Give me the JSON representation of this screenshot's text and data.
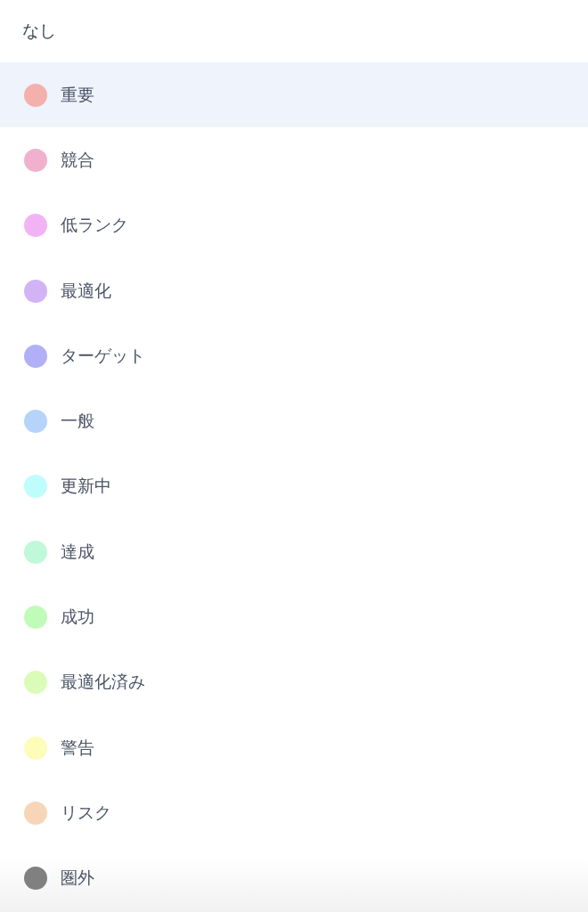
{
  "options": [
    {
      "label": "なし",
      "selected": false
    },
    {
      "label": "重要",
      "color": "#f4b0ab",
      "selected": true
    },
    {
      "label": "競合",
      "color": "#f2b0cf",
      "selected": false
    },
    {
      "label": "低ランク",
      "color": "#f2b3f5",
      "selected": false
    },
    {
      "label": "最適化",
      "color": "#d2b3f6",
      "selected": false
    },
    {
      "label": "ターゲット",
      "color": "#b1b0f7",
      "selected": false
    },
    {
      "label": "一般",
      "color": "#b6d3fa",
      "selected": false
    },
    {
      "label": "更新中",
      "color": "#bffcfc",
      "selected": false
    },
    {
      "label": "達成",
      "color": "#bff9d9",
      "selected": false
    },
    {
      "label": "成功",
      "color": "#bffcb9",
      "selected": false
    },
    {
      "label": "最適化済み",
      "color": "#dbfcb9",
      "selected": false
    },
    {
      "label": "警告",
      "color": "#fefcb9",
      "selected": false
    },
    {
      "label": "リスク",
      "color": "#f6d6b6",
      "selected": false
    },
    {
      "label": "圏外",
      "color": "#808080",
      "selected": false
    }
  ]
}
